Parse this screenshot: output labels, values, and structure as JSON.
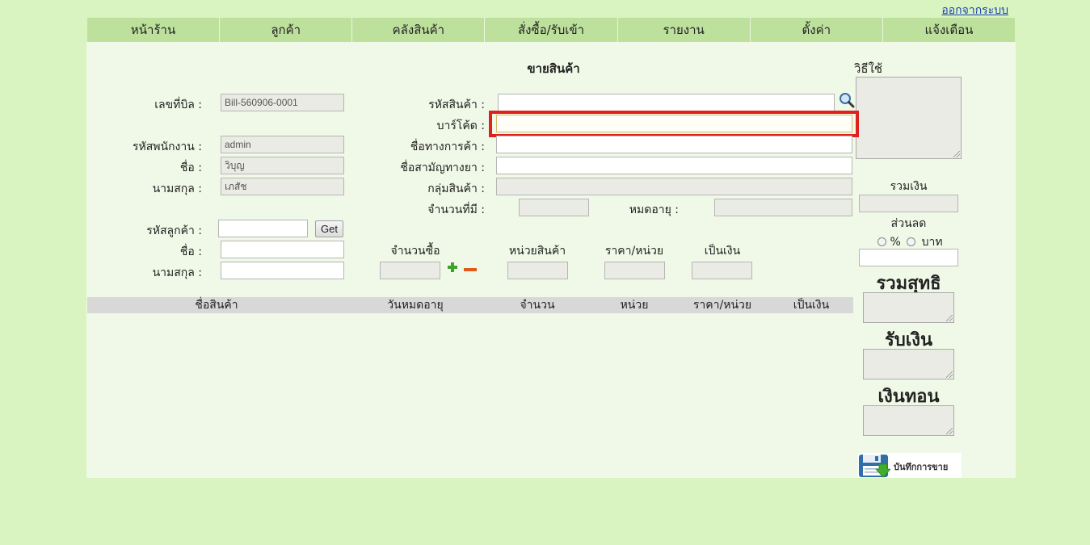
{
  "logout_label": "ออกจากระบบ",
  "nav": [
    "หน้าร้าน",
    "ลูกค้า",
    "คลังสินค้า",
    "สั่งซื้อ/รับเข้า",
    "รายงาน",
    "ตั้งค่า",
    "แจ้งเตือน"
  ],
  "page_title": "ขายสินค้า",
  "help_label": "วิธีใช้",
  "bill": {
    "label": "เลขที่บิล :",
    "value": "Bill-560906-0001"
  },
  "employee": {
    "id_label": "รหัสพนักงาน :",
    "id_value": "admin",
    "name_label": "ชื่อ :",
    "name_value": "วิบุญ",
    "surname_label": "นามสกุล :",
    "surname_value": "เภสัช"
  },
  "customer": {
    "id_label": "รหัสลูกค้า :",
    "id_value": "",
    "get_label": "Get",
    "name_label": "ชื่อ :",
    "name_value": "",
    "surname_label": "นามสกุล :",
    "surname_value": ""
  },
  "product": {
    "code_label": "รหัสสินค้า :",
    "barcode_label": "บาร์โค้ด :",
    "trade_name_label": "ชื่อทางการค้า :",
    "generic_name_label": "ชื่อสามัญทางยา :",
    "group_label": "กลุ่มสินค้า :",
    "stock_label": "จำนวนที่มี :",
    "expiry_label": "หมดอายุ :"
  },
  "order": {
    "qty_label": "จำนวนซื้อ",
    "unit_label": "หน่วยสินค้า",
    "price_label": "ราคา/หน่วย",
    "amount_label": "เป็นเงิน"
  },
  "table_headers": [
    "ชื่อสินค้า",
    "วันหมดอายุ",
    "จำนวน",
    "หน่วย",
    "ราคา/หน่วย",
    "เป็นเงิน"
  ],
  "summary": {
    "total_label": "รวมเงิน",
    "discount_label": "ส่วนลด",
    "percent_label": "%",
    "baht_label": "บาท",
    "net_label": "รวมสุทธิ",
    "received_label": "รับเงิน",
    "change_label": "เงินทอน",
    "save_label": "บันทึกการขาย"
  }
}
